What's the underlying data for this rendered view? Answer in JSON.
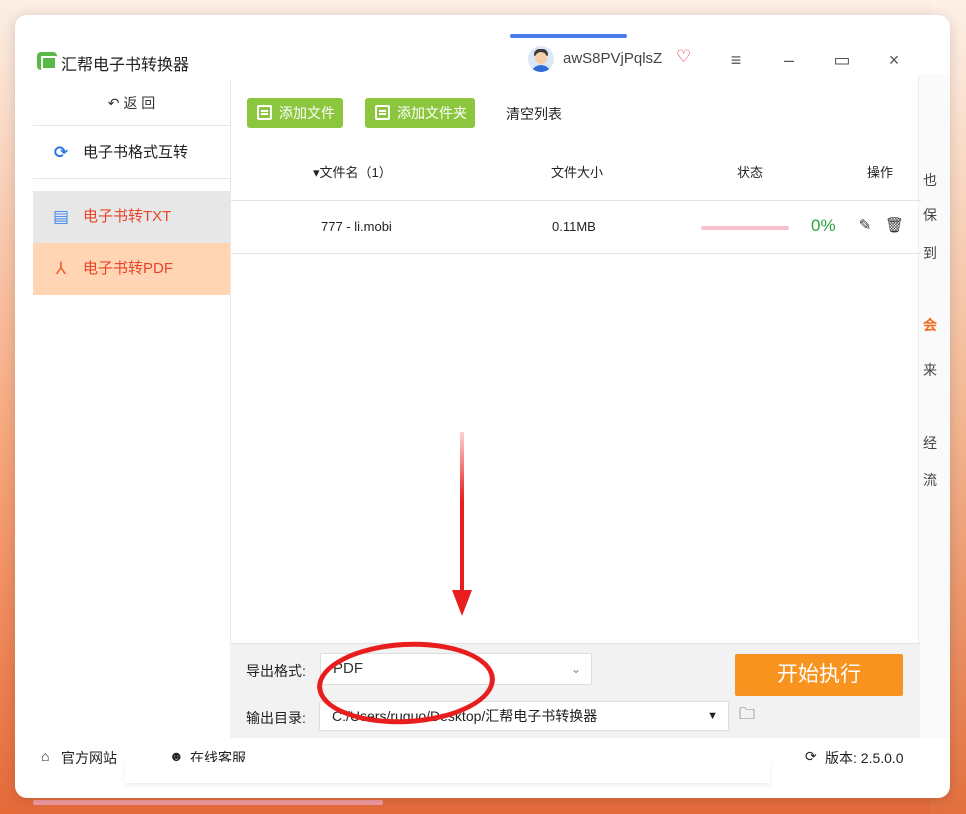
{
  "app": {
    "title": "汇帮电子书转换器",
    "username": "awS8PVjPqlsZ"
  },
  "window_controls": {
    "menu_icon": "≡",
    "minimize_icon": "–",
    "maximize_icon": "▭",
    "close_icon": "×"
  },
  "sidebar": {
    "back_label": "返 回",
    "items": [
      {
        "label": "电子书格式互转",
        "icon": "refresh-icon"
      },
      {
        "label": "电子书转TXT",
        "icon": "document-icon"
      },
      {
        "label": "电子书转PDF",
        "icon": "pdf-icon"
      }
    ]
  },
  "toolbar": {
    "add_file": "添加文件",
    "add_folder": "添加文件夹",
    "clear_list": "清空列表"
  },
  "table": {
    "headers": {
      "filename": "▾文件名（1）",
      "size": "文件大小",
      "status": "状态",
      "action": "操作"
    },
    "rows": [
      {
        "filename": "777 - li.mobi",
        "size": "0.11MB",
        "progress": 0,
        "progress_label": "0%"
      }
    ]
  },
  "export": {
    "format_label": "导出格式:",
    "format_value": "PDF",
    "output_label": "输出目录:",
    "output_value": "C:/Users/ruguo/Desktop/汇帮电子书转换器",
    "start_button": "开始执行"
  },
  "footer": {
    "website": "官方网站",
    "support": "在线客服",
    "version": "版本: 2.5.0.0"
  },
  "background_peek": [
    "也",
    "保",
    "到",
    "会",
    "来",
    "经",
    "流"
  ],
  "colors": {
    "green_button": "#8cc63f",
    "orange_button": "#f7931e",
    "active_sidebar": "#ffd5b3",
    "annotation_red": "#e81e1e",
    "progress_green": "#2aa43b"
  }
}
